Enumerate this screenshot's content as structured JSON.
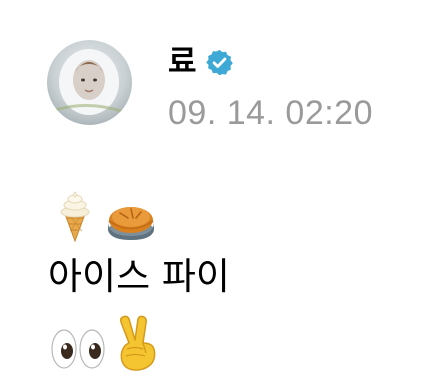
{
  "post": {
    "author": {
      "name": "료",
      "verified": true,
      "verified_color": "#3fa9d6"
    },
    "timestamp": "09. 14. 02:20",
    "body_text": "아이스 파이",
    "emoji_line_1": [
      "soft-ice-cream",
      "pie"
    ],
    "emoji_line_2": [
      "eyes",
      "victory-hand"
    ]
  }
}
